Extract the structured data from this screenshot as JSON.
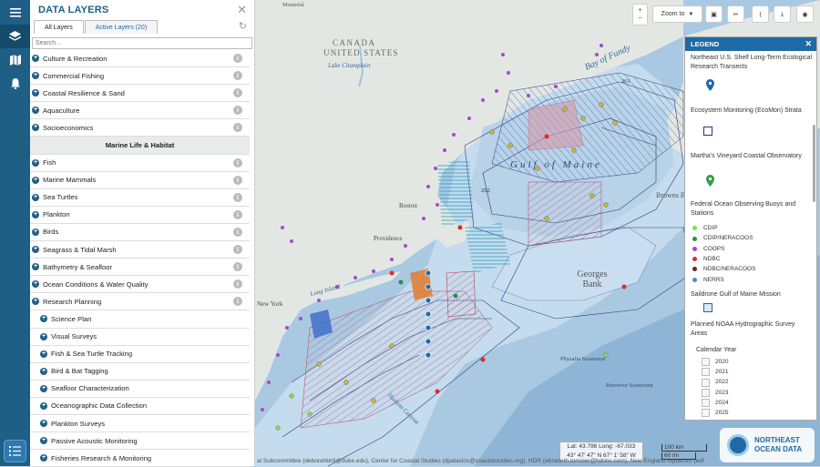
{
  "rail": {
    "icons": [
      "menu-icon",
      "layers-icon",
      "map-icon",
      "bell-icon",
      "list-icon"
    ]
  },
  "panel": {
    "title": "DATA LAYERS",
    "tabs": [
      {
        "label": "All Layers"
      },
      {
        "label": "Active Layers (20)"
      }
    ],
    "search_placeholder": "Search...",
    "rows": [
      {
        "label": "Culture & Recreation",
        "kind": "cat"
      },
      {
        "label": "Commercial Fishing",
        "kind": "cat"
      },
      {
        "label": "Coastal Resilience & Sand",
        "kind": "cat"
      },
      {
        "label": "Aquaculture",
        "kind": "cat"
      },
      {
        "label": "Socioeconomics",
        "kind": "cat"
      },
      {
        "label": "Marine Life & Habitat",
        "kind": "section"
      },
      {
        "label": "Fish",
        "kind": "cat"
      },
      {
        "label": "Marine Mammals",
        "kind": "cat"
      },
      {
        "label": "Sea Turtles",
        "kind": "cat"
      },
      {
        "label": "Plankton",
        "kind": "cat"
      },
      {
        "label": "Birds",
        "kind": "cat"
      },
      {
        "label": "Seagrass & Tidal Marsh",
        "kind": "cat"
      },
      {
        "label": "Bathymetry & Seafloor",
        "kind": "cat"
      },
      {
        "label": "Ocean Conditions & Water Quality",
        "kind": "cat"
      },
      {
        "label": "Research Planning",
        "kind": "cat"
      },
      {
        "label": "Science Plan",
        "kind": "sub"
      },
      {
        "label": "Visual Surveys",
        "kind": "sub"
      },
      {
        "label": "Fish & Sea Turtle Tracking",
        "kind": "sub"
      },
      {
        "label": "Bird & Bat Tagging",
        "kind": "sub"
      },
      {
        "label": "Seafloor Characterization",
        "kind": "sub"
      },
      {
        "label": "Oceanographic Data Collection",
        "kind": "sub"
      },
      {
        "label": "Plankton Surveys",
        "kind": "sub"
      },
      {
        "label": "Passive Acoustic Monitoring",
        "kind": "sub"
      },
      {
        "label": "Fisheries Research & Monitoring",
        "kind": "sub"
      }
    ]
  },
  "toolbar": {
    "zoom_label": "Zoom to"
  },
  "map_labels": {
    "canada": "CANADA",
    "united_states": "UNITED STATES",
    "bay_of_fundy": "Bay of Fundy",
    "gulf_of_maine": "Gulf of Maine",
    "georges_bank": "Georges Bank",
    "browns_bank": "Browns Bank",
    "lake_champlain": "Lake Champlain",
    "boston": "Boston",
    "providence": "Providence",
    "new_york": "New York",
    "long_island": "Long Island",
    "hudson_canyon": "Hudson Canyon",
    "physalia_seamount": "Physalia Seamount",
    "retriever_seamount": "Retriever Seamount",
    "montreal": "Montréal",
    "depth_292": "292",
    "depth_261": "261"
  },
  "legend": {
    "title": "LEGEND",
    "items": [
      {
        "label": "Northeast U.S. Shelf Long-Term Ecological Research Transects"
      },
      {
        "label": "Ecosystem Monitoring (EcoMon) Strata"
      },
      {
        "label": "Martha's Vineyard Coastal Observatory"
      },
      {
        "label": "Federal Ocean Observing Buoys and Stations"
      },
      {
        "label": "Saildrone Gulf of Maine Mission"
      },
      {
        "label": "Planned NOAA Hydrographic Survey Areas"
      }
    ],
    "buoys": [
      {
        "label": "CDIP",
        "color": "#7ee04a"
      },
      {
        "label": "CDIP/NERACOOS",
        "color": "#2e8b57"
      },
      {
        "label": "COOPS",
        "color": "#a64ac9"
      },
      {
        "label": "NDBC",
        "color": "#e02a2a"
      },
      {
        "label": "NDBC/NERACOOS",
        "color": "#7a1f1f"
      },
      {
        "label": "NERRS",
        "color": "#4a8ec2"
      }
    ],
    "calendar_label": "Calendar Year",
    "years": [
      "2020",
      "2021",
      "2022",
      "2023",
      "2024",
      "2025"
    ]
  },
  "coords": {
    "line1": "Lat: 43.796  Long: -67.033",
    "line2": "43° 47' 47\" N 67° 1' 58\" W"
  },
  "scale": {
    "km": "100 km",
    "mi": "60 mi"
  },
  "attribution": "al Subcommittee (deborahbrill@duke.edu), Center for Coastal Studies (dpalacios@coastalstudies.org), HDR (elizabeth.tomnier@hdrinc.com), New England Aquarium (edf",
  "logo": {
    "line1": "NORTHEAST",
    "line2": "OCEAN DATA"
  },
  "colors": {
    "brand": "#1f5f86",
    "accent": "#1f6aa5"
  }
}
